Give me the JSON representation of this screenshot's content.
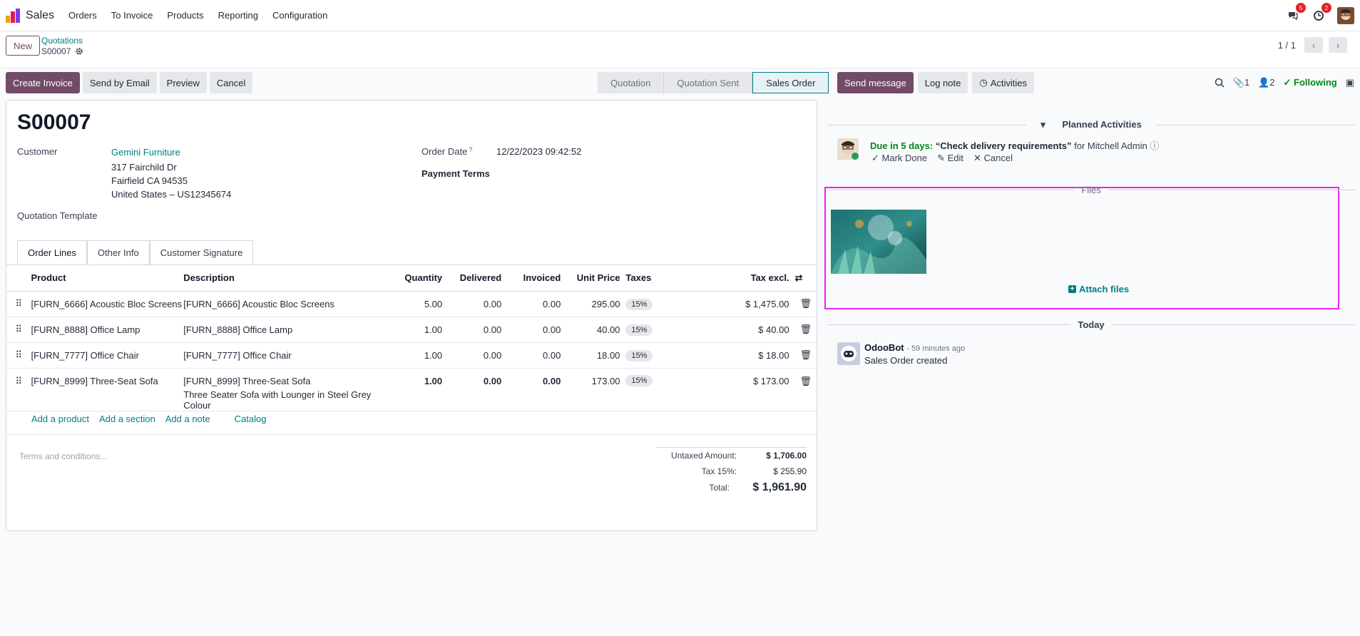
{
  "navbar": {
    "app_name": "Sales",
    "menu": [
      "Orders",
      "To Invoice",
      "Products",
      "Reporting",
      "Configuration"
    ],
    "messages_badge": "5",
    "activities_badge": "2"
  },
  "control_panel": {
    "new_label": "New",
    "breadcrumb": "Quotations",
    "record": "S00007",
    "pager": "1 / 1"
  },
  "actions": {
    "create_invoice": "Create Invoice",
    "send_email": "Send by Email",
    "preview": "Preview",
    "cancel": "Cancel"
  },
  "status": {
    "steps": [
      "Quotation",
      "Quotation Sent",
      "Sales Order"
    ],
    "active": "Sales Order"
  },
  "form": {
    "title": "S00007",
    "customer_label": "Customer",
    "customer_name": "Gemini Furniture",
    "address_line1": "317 Fairchild Dr",
    "address_line2": "Fairfield CA 94535",
    "address_line3": "United States – US12345674",
    "quotation_template_label": "Quotation Template",
    "order_date_label": "Order Date",
    "order_date_help": "?",
    "order_date_value": "12/22/2023 09:42:52",
    "payment_terms_label": "Payment Terms",
    "tabs": [
      "Order Lines",
      "Other Info",
      "Customer Signature"
    ],
    "columns": {
      "product": "Product",
      "description": "Description",
      "quantity": "Quantity",
      "delivered": "Delivered",
      "invoiced": "Invoiced",
      "unit_price": "Unit Price",
      "taxes": "Taxes",
      "tax_excl": "Tax excl."
    },
    "lines": [
      {
        "product": "[FURN_6666] Acoustic Bloc Screens",
        "description": "[FURN_6666] Acoustic Bloc Screens",
        "description2": "",
        "quantity": "5.00",
        "delivered": "0.00",
        "invoiced": "0.00",
        "unit_price": "295.00",
        "tax": "15%",
        "subtotal": "$ 1,475.00"
      },
      {
        "product": "[FURN_8888] Office Lamp",
        "description": "[FURN_8888] Office Lamp",
        "description2": "",
        "quantity": "1.00",
        "delivered": "0.00",
        "invoiced": "0.00",
        "unit_price": "40.00",
        "tax": "15%",
        "subtotal": "$ 40.00"
      },
      {
        "product": "[FURN_7777] Office Chair",
        "description": "[FURN_7777] Office Chair",
        "description2": "",
        "quantity": "1.00",
        "delivered": "0.00",
        "invoiced": "0.00",
        "unit_price": "18.00",
        "tax": "15%",
        "subtotal": "$ 18.00"
      },
      {
        "product": "[FURN_8999] Three-Seat Sofa",
        "description": "[FURN_8999] Three-Seat Sofa",
        "description2": "Three Seater Sofa with Lounger in Steel Grey Colour",
        "quantity": "1.00",
        "delivered": "0.00",
        "invoiced": "0.00",
        "unit_price": "173.00",
        "tax": "15%",
        "subtotal": "$ 173.00"
      }
    ],
    "add_product": "Add a product",
    "add_section": "Add a section",
    "add_note": "Add a note",
    "catalog": "Catalog",
    "terms_placeholder": "Terms and conditions...",
    "untaxed_label": "Untaxed Amount:",
    "untaxed_value": "$ 1,706.00",
    "tax_label": "Tax 15%:",
    "tax_value": "$ 255.90",
    "total_label": "Total:",
    "total_value": "$ 1,961.90"
  },
  "chatter": {
    "send_message": "Send message",
    "log_note": "Log note",
    "activities": "Activities",
    "attachments_count": "1",
    "followers_count": "2",
    "following": "Following",
    "planned_title": "Planned Activities",
    "due": "Due in 5 days:",
    "activity_name": "“Check delivery requirements”",
    "activity_for": "for Mitchell Admin",
    "mark_done": "Mark Done",
    "edit": "Edit",
    "cancel": "Cancel",
    "files_title": "Files",
    "attach_files": "Attach files",
    "today": "Today",
    "author": "OdooBot",
    "time": "- 59 minutes ago",
    "body": "Sales Order created"
  },
  "colors": {
    "brand": "#714b67",
    "link": "#017e84",
    "success": "#008818",
    "highlight_box": "#ee22ee"
  }
}
